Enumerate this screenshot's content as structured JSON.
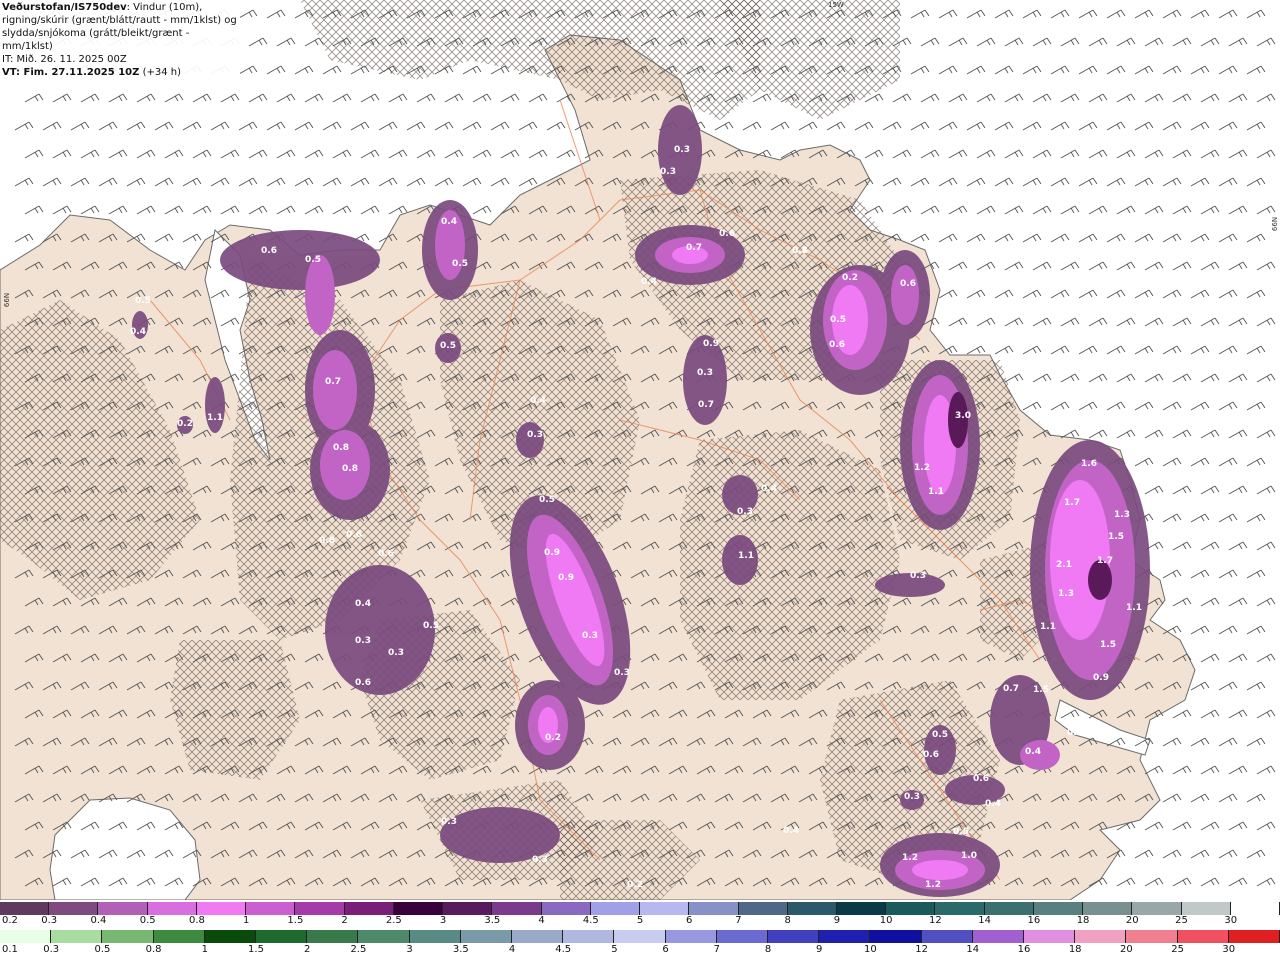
{
  "header": {
    "brand": "Veðurstofan/IS750dev",
    "desc1": ": Vindur (10m),",
    "desc2": "rigning/skúrir (grænt/blátt/rautt - mm/1klst) og",
    "desc3": "slydda/snjókoma (grátt/bleikt/grænt - mm/1klst)",
    "it": "IT: Mið. 26. 11. 2025 00Z",
    "vt": "VT: Fim. 27.11.2025 10Z",
    "vt_offset": "(+34 h)"
  },
  "coords": {
    "top": "15W",
    "right": "66N",
    "left": "66N"
  },
  "colors": {
    "land": "#f1e2d3",
    "sea": "#ffffff",
    "snow_light": "#8e4a8a",
    "snow_mid": "#c264c6",
    "snow_high": "#f07af4",
    "snow_peak": "#5a1a5a",
    "roads": "#e98a5c"
  },
  "legend_top": {
    "labels": [
      "0.2",
      "0.3",
      "0.4",
      "0.5",
      "0.8",
      "1",
      "1.5",
      "2",
      "2.5",
      "3",
      "3.5",
      "4",
      "4.5",
      "5",
      "6",
      "7",
      "8",
      "9",
      "10",
      "12",
      "14",
      "16",
      "18",
      "20",
      "25",
      "30"
    ],
    "colors": [
      "#5e3a5e",
      "#7e4a80",
      "#b25fb8",
      "#d86ee0",
      "#f07af4",
      "#cc5fd0",
      "#a63aa8",
      "#7a1e7a",
      "#3a003a",
      "#5a1a5e",
      "#7a3a8e",
      "#8a6ac0",
      "#a0a0e8",
      "#b8b8f0",
      "#8890c8",
      "#506888",
      "#2a5a6a",
      "#0a3a48",
      "#1a5a5a",
      "#2a6a6a",
      "#3a7070",
      "#588080",
      "#789090",
      "#98a8a8",
      "#c0c8c8",
      "#ffffff"
    ]
  },
  "legend_bottom": {
    "labels": [
      "0.1",
      "0.3",
      "0.5",
      "0.8",
      "1",
      "1.5",
      "2",
      "2.5",
      "3",
      "3.5",
      "4",
      "4.5",
      "5",
      "6",
      "7",
      "8",
      "9",
      "10",
      "12",
      "14",
      "16",
      "18",
      "20",
      "25",
      "30"
    ],
    "colors": [
      "#e6ffe6",
      "#a8dca0",
      "#78b870",
      "#3e8a3e",
      "#0a4a0a",
      "#1e6a2e",
      "#3a7a4a",
      "#4e8a6a",
      "#5a8a84",
      "#7a9aaa",
      "#98aac8",
      "#b0b8e0",
      "#c8ccf0",
      "#9898e0",
      "#6a6ad0",
      "#4040c0",
      "#2020b0",
      "#1010a0",
      "#5050c0",
      "#a060d0",
      "#e090e0",
      "#f0a0c0",
      "#f08090",
      "#f05060",
      "#e02020"
    ]
  },
  "precip_labels": [
    "0.3",
    "0.3",
    "0.4",
    "0.7",
    "0.6",
    "0.4",
    "0.2",
    "0.6",
    "0.5",
    "0.6",
    "0.9",
    "0.3",
    "0.7",
    "0.4",
    "0.5",
    "3.0",
    "1.2",
    "1.1",
    "0.4",
    "0.6",
    "0.5",
    "0.5",
    "0.8",
    "0.7",
    "0.8",
    "0.8",
    "0.6",
    "0.6",
    "0.4",
    "0.3",
    "0.3",
    "0.5",
    "0.6",
    "0.5",
    "0.9",
    "0.9",
    "0.3",
    "0.3",
    "0.3",
    "1.1",
    "0.3",
    "0.4",
    "0.3",
    "0.2",
    "0.3",
    "0.3",
    "0.2",
    "0.2",
    "1.1",
    "1.6",
    "1.7",
    "1.3",
    "1.5",
    "2.1",
    "1.7",
    "1.3",
    "1.1",
    "1.1",
    "1.5",
    "0.9",
    "0.7",
    "1.5",
    "0.4",
    "0.4",
    "0.5",
    "0.6",
    "0.6",
    "0.4",
    "0.3",
    "0.5",
    "1.2",
    "1.0",
    "1.2",
    "0.4",
    "0.3",
    "0.5",
    "0.4",
    "0.2"
  ]
}
